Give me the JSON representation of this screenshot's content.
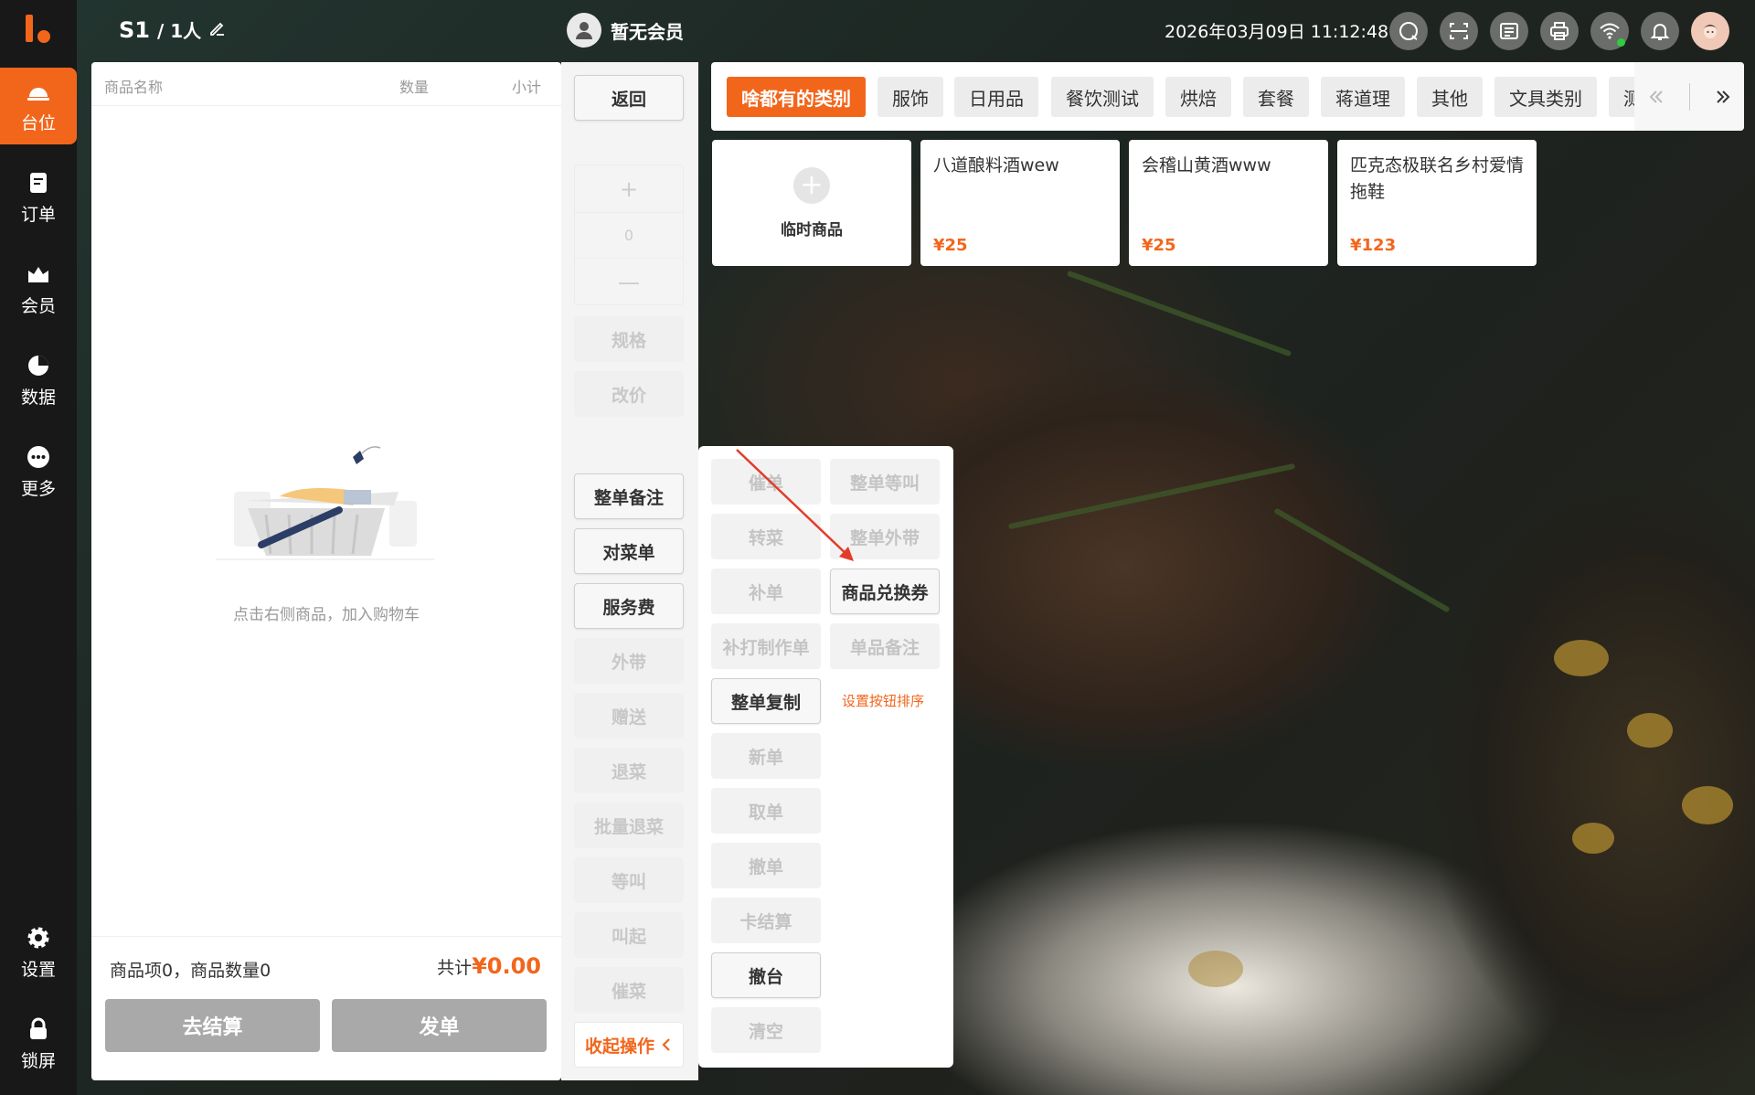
{
  "header": {
    "table": "S1",
    "people": "/ 1人",
    "member": "暂无会员",
    "datetime": "2026年03月09日 11:12:48"
  },
  "nav": {
    "items": [
      {
        "label": "台位",
        "icon": "table-icon"
      },
      {
        "label": "订单",
        "icon": "order-icon"
      },
      {
        "label": "会员",
        "icon": "member-icon"
      },
      {
        "label": "数据",
        "icon": "chart-icon"
      },
      {
        "label": "更多",
        "icon": "more-icon"
      },
      {
        "label": "设置",
        "icon": "gear-icon"
      },
      {
        "label": "锁屏",
        "icon": "lock-icon"
      }
    ]
  },
  "cart": {
    "col_name": "商品名称",
    "col_qty": "数量",
    "col_subtotal": "小计",
    "empty_text": "点击右侧商品，加入购物车",
    "summary": "商品项0，商品数量0",
    "total_label": "共计",
    "total_value": "¥0.00",
    "checkout": "去结算",
    "send": "发单"
  },
  "actions": {
    "back": "返回",
    "stepper_plus": "+",
    "stepper_value": "0",
    "stepper_minus": "—",
    "spec": "规格",
    "reprice": "改价",
    "order_note": "整单备注",
    "check_menu": "对菜单",
    "service_fee": "服务费",
    "takeout": "外带",
    "gift": "赠送",
    "return_dish": "退菜",
    "batch_return": "批量退菜",
    "hold": "等叫",
    "call_up": "叫起",
    "rush": "催菜",
    "collapse": "收起操作"
  },
  "popup": {
    "rush_order": "催单",
    "whole_hold": "整单等叫",
    "transfer_dish": "转菜",
    "whole_takeout": "整单外带",
    "add_order": "补单",
    "coupon": "商品兑换券",
    "reprint": "补打制作单",
    "item_note": "单品备注",
    "copy_order": "整单复制",
    "sort_buttons": "设置按钮排序",
    "new_order": "新单",
    "take_order": "取单",
    "cancel_order": "撤单",
    "card_settle": "卡结算",
    "clear_table": "撤台",
    "clear": "清空"
  },
  "categories": [
    "啥都有的类别",
    "服饰",
    "日用品",
    "餐饮测试",
    "烘焙",
    "套餐",
    "蒋道理",
    "其他",
    "文具类别",
    "测"
  ],
  "products": [
    {
      "name": "临时商品",
      "price": ""
    },
    {
      "name": "八道酿料酒wew",
      "price": "¥25"
    },
    {
      "name": "会稽山黄酒www",
      "price": "¥25"
    },
    {
      "name": "匹克态极联名乡村爱情拖鞋",
      "price": "¥123"
    }
  ],
  "colors": {
    "accent": "#f2661c",
    "nav_bg": "#171817"
  }
}
